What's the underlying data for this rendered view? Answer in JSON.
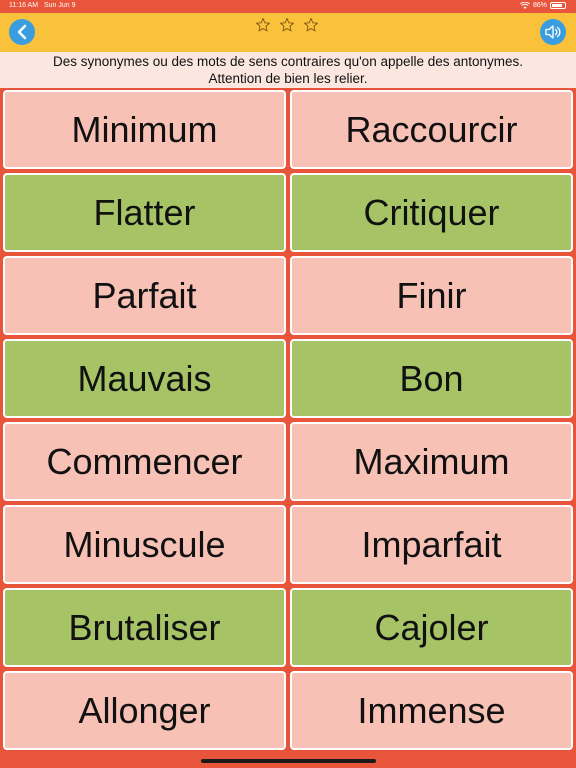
{
  "status_bar": {
    "time": "11:16 AM",
    "date": "Sun Jun 9",
    "battery": "86%",
    "battery_level": 0.86
  },
  "header": {
    "stars_filled": 0,
    "stars_total": 3,
    "back_icon": "chevron-left-icon",
    "sound_icon": "speaker-icon"
  },
  "instructions": {
    "line1": "Des synonymes ou des mots de sens contraires qu'on appelle des antonymes.",
    "line2": "Attention de bien les relier."
  },
  "colors": {
    "card_default": "#f8c1b6",
    "card_matched": "#a6c466",
    "header": "#f9c23a",
    "background": "#e8553a",
    "button": "#3a9de0"
  },
  "cards": {
    "left": [
      {
        "label": "Minimum",
        "state": "default"
      },
      {
        "label": "Flatter",
        "state": "matched"
      },
      {
        "label": "Parfait",
        "state": "default"
      },
      {
        "label": "Mauvais",
        "state": "matched"
      },
      {
        "label": "Commencer",
        "state": "default"
      },
      {
        "label": "Minuscule",
        "state": "default"
      },
      {
        "label": "Brutaliser",
        "state": "matched"
      },
      {
        "label": "Allonger",
        "state": "default"
      }
    ],
    "right": [
      {
        "label": "Raccourcir",
        "state": "default"
      },
      {
        "label": "Critiquer",
        "state": "matched"
      },
      {
        "label": "Finir",
        "state": "default"
      },
      {
        "label": "Bon",
        "state": "matched"
      },
      {
        "label": "Maximum",
        "state": "default"
      },
      {
        "label": "Imparfait",
        "state": "default"
      },
      {
        "label": "Cajoler",
        "state": "matched"
      },
      {
        "label": "Immense",
        "state": "default"
      }
    ]
  }
}
